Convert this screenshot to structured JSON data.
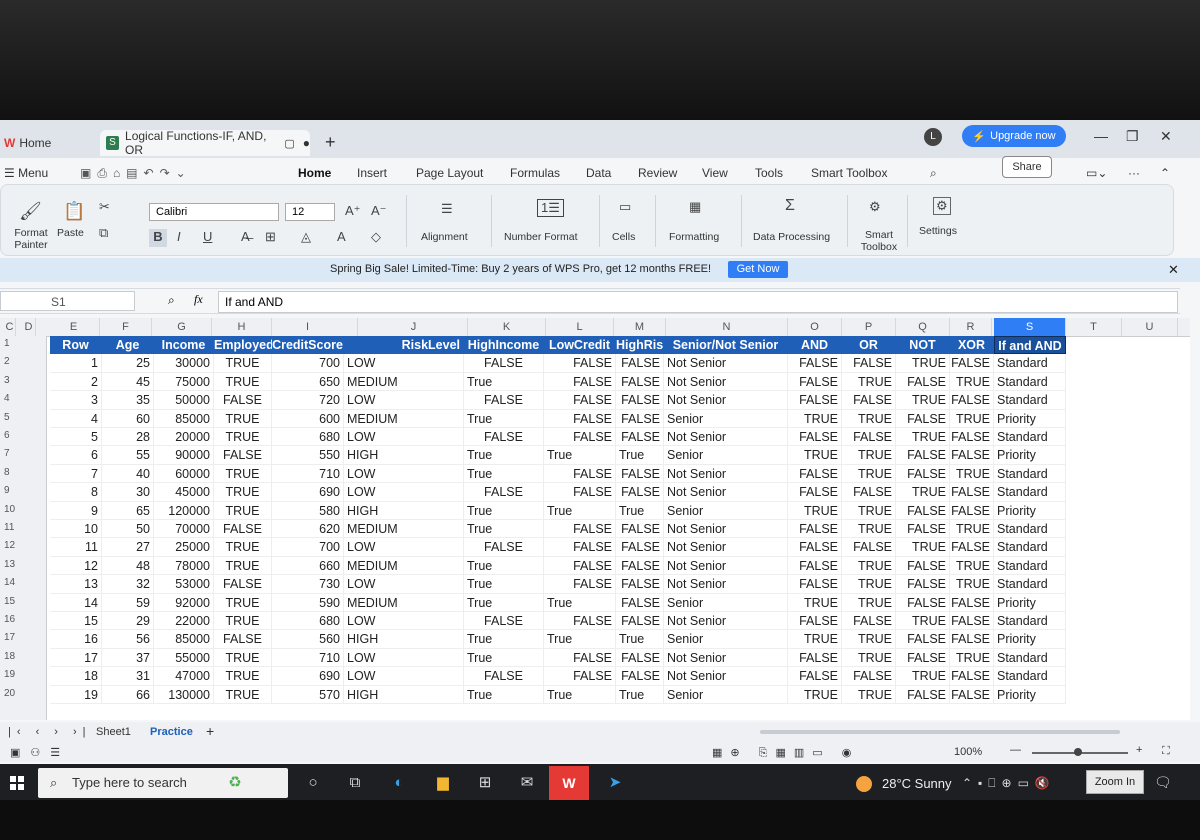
{
  "tabs": {
    "home": "Home",
    "doc": "Logical Functions-IF, AND, OR"
  },
  "upgrade": "Upgrade now",
  "avatar_initial": "L",
  "menu": {
    "label": "Menu",
    "items": [
      "Home",
      "Insert",
      "Page Layout",
      "Formulas",
      "Data",
      "Review",
      "View",
      "Tools",
      "Smart Toolbox"
    ],
    "share": "Share"
  },
  "ribbon": {
    "format_painter": "Format Painter",
    "paste": "Paste",
    "font_name": "Calibri",
    "font_size": "12",
    "alignment": "Alignment",
    "number_format": "Number Format",
    "cells": "Cells",
    "formatting": "Formatting",
    "data_processing": "Data Processing",
    "smart_toolbox": "Smart Toolbox",
    "settings": "Settings"
  },
  "banner": {
    "text": "Spring Big Sale! Limited-Time: Buy 2 years of WPS Pro, get 12 months FREE!",
    "button": "Get Now"
  },
  "formula_bar": {
    "cell": "S1",
    "fx": "fx",
    "formula": "If and AND"
  },
  "columns": [
    "C",
    "D",
    "E",
    "F",
    "G",
    "H",
    "I",
    "J",
    "K",
    "L",
    "M",
    "N",
    "O",
    "P",
    "Q",
    "R",
    "S",
    "T",
    "U"
  ],
  "row_numbers": [
    "1",
    "2",
    "3",
    "4",
    "5",
    "6",
    "7",
    "8",
    "9",
    "10",
    "11",
    "12",
    "13",
    "14",
    "15",
    "16",
    "17",
    "18",
    "19",
    "20"
  ],
  "headers": [
    "Row",
    "Age",
    "Income",
    "Employed",
    "CreditScore",
    "RiskLevel",
    "HighIncome",
    "LowCredit",
    "HighRisk",
    "Senior/Not Senior",
    "AND",
    "OR",
    "NOT",
    "XOR",
    "If and AND"
  ],
  "rows": [
    [
      "1",
      "25",
      "30000",
      "TRUE",
      "700",
      "LOW",
      "FALSE",
      "FALSE",
      "FALSE",
      "Not Senior",
      "FALSE",
      "FALSE",
      "TRUE",
      "FALSE",
      "Standard"
    ],
    [
      "2",
      "45",
      "75000",
      "TRUE",
      "650",
      "MEDIUM",
      "True",
      "FALSE",
      "FALSE",
      "Not Senior",
      "FALSE",
      "TRUE",
      "FALSE",
      "TRUE",
      "Standard"
    ],
    [
      "3",
      "35",
      "50000",
      "FALSE",
      "720",
      "LOW",
      "FALSE",
      "FALSE",
      "FALSE",
      "Not Senior",
      "FALSE",
      "FALSE",
      "TRUE",
      "FALSE",
      "Standard"
    ],
    [
      "4",
      "60",
      "85000",
      "TRUE",
      "600",
      "MEDIUM",
      "True",
      "FALSE",
      "FALSE",
      "Senior",
      "TRUE",
      "TRUE",
      "FALSE",
      "TRUE",
      "Priority"
    ],
    [
      "5",
      "28",
      "20000",
      "TRUE",
      "680",
      "LOW",
      "FALSE",
      "FALSE",
      "FALSE",
      "Not Senior",
      "FALSE",
      "FALSE",
      "TRUE",
      "FALSE",
      "Standard"
    ],
    [
      "6",
      "55",
      "90000",
      "FALSE",
      "550",
      "HIGH",
      "True",
      "True",
      "True",
      "Senior",
      "TRUE",
      "TRUE",
      "FALSE",
      "FALSE",
      "Priority"
    ],
    [
      "7",
      "40",
      "60000",
      "TRUE",
      "710",
      "LOW",
      "True",
      "FALSE",
      "FALSE",
      "Not Senior",
      "FALSE",
      "TRUE",
      "FALSE",
      "TRUE",
      "Standard"
    ],
    [
      "8",
      "30",
      "45000",
      "TRUE",
      "690",
      "LOW",
      "FALSE",
      "FALSE",
      "FALSE",
      "Not Senior",
      "FALSE",
      "FALSE",
      "TRUE",
      "FALSE",
      "Standard"
    ],
    [
      "9",
      "65",
      "120000",
      "TRUE",
      "580",
      "HIGH",
      "True",
      "True",
      "True",
      "Senior",
      "TRUE",
      "TRUE",
      "FALSE",
      "FALSE",
      "Priority"
    ],
    [
      "10",
      "50",
      "70000",
      "FALSE",
      "620",
      "MEDIUM",
      "True",
      "FALSE",
      "FALSE",
      "Not Senior",
      "FALSE",
      "TRUE",
      "FALSE",
      "TRUE",
      "Standard"
    ],
    [
      "11",
      "27",
      "25000",
      "TRUE",
      "700",
      "LOW",
      "FALSE",
      "FALSE",
      "FALSE",
      "Not Senior",
      "FALSE",
      "FALSE",
      "TRUE",
      "FALSE",
      "Standard"
    ],
    [
      "12",
      "48",
      "78000",
      "TRUE",
      "660",
      "MEDIUM",
      "True",
      "FALSE",
      "FALSE",
      "Not Senior",
      "FALSE",
      "TRUE",
      "FALSE",
      "TRUE",
      "Standard"
    ],
    [
      "13",
      "32",
      "53000",
      "FALSE",
      "730",
      "LOW",
      "True",
      "FALSE",
      "FALSE",
      "Not Senior",
      "FALSE",
      "TRUE",
      "FALSE",
      "TRUE",
      "Standard"
    ],
    [
      "14",
      "59",
      "92000",
      "TRUE",
      "590",
      "MEDIUM",
      "True",
      "True",
      "FALSE",
      "Senior",
      "TRUE",
      "TRUE",
      "FALSE",
      "FALSE",
      "Priority"
    ],
    [
      "15",
      "29",
      "22000",
      "TRUE",
      "680",
      "LOW",
      "FALSE",
      "FALSE",
      "FALSE",
      "Not Senior",
      "FALSE",
      "FALSE",
      "TRUE",
      "FALSE",
      "Standard"
    ],
    [
      "16",
      "56",
      "85000",
      "FALSE",
      "560",
      "HIGH",
      "True",
      "True",
      "True",
      "Senior",
      "TRUE",
      "TRUE",
      "FALSE",
      "FALSE",
      "Priority"
    ],
    [
      "17",
      "37",
      "55000",
      "TRUE",
      "710",
      "LOW",
      "True",
      "FALSE",
      "FALSE",
      "Not Senior",
      "FALSE",
      "TRUE",
      "FALSE",
      "TRUE",
      "Standard"
    ],
    [
      "18",
      "31",
      "47000",
      "TRUE",
      "690",
      "LOW",
      "FALSE",
      "FALSE",
      "FALSE",
      "Not Senior",
      "FALSE",
      "FALSE",
      "TRUE",
      "FALSE",
      "Standard"
    ],
    [
      "19",
      "66",
      "130000",
      "TRUE",
      "570",
      "HIGH",
      "True",
      "True",
      "True",
      "Senior",
      "TRUE",
      "TRUE",
      "FALSE",
      "FALSE",
      "Priority"
    ]
  ],
  "sheets": [
    "Sheet1",
    "Practice"
  ],
  "active_sheet": "Practice",
  "zoom": "100%",
  "taskbar": {
    "search_placeholder": "Type here to search",
    "weather": "28°C  Sunny",
    "zoom_in": "Zoom In"
  },
  "colors": {
    "header_blue": "#1f5fb8",
    "accent": "#2f7ef5",
    "wps_red": "#e53935"
  }
}
